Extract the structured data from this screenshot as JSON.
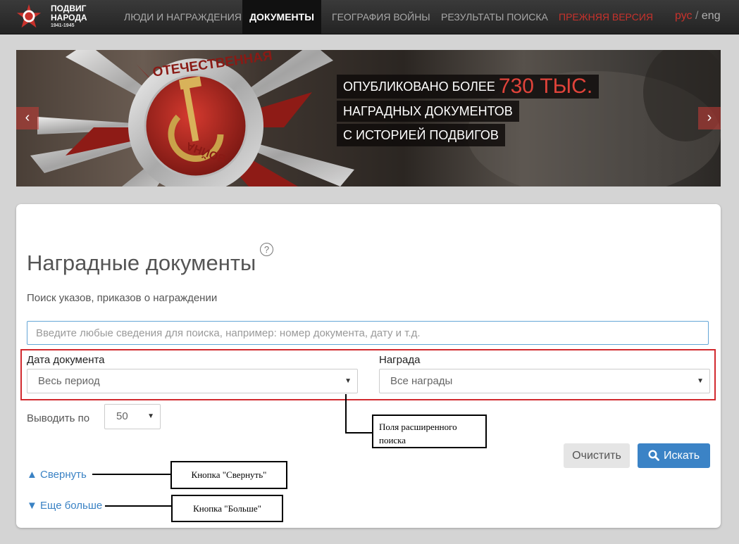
{
  "header": {
    "logo_line1": "ПОДВИГ",
    "logo_line2": "НАРОДА",
    "logo_years": "1941-1945",
    "nav": [
      {
        "label": "ЛЮДИ И НАГРАЖДЕНИЯ",
        "active": false
      },
      {
        "label": "ДОКУМЕНТЫ",
        "active": true
      },
      {
        "label": "ГЕОГРАФИЯ ВОЙНЫ",
        "active": false
      },
      {
        "label": "РЕЗУЛЬТАТЫ ПОИСКА",
        "active": false
      },
      {
        "label": "ПРЕЖНЯЯ ВЕРСИЯ",
        "active": false
      }
    ],
    "lang_ru": "рус",
    "lang_sep": "/",
    "lang_en": "eng"
  },
  "banner": {
    "line1_prefix": "ОПУБЛИКОВАНО БОЛЕЕ",
    "line1_highlight": "730 ТЫС.",
    "line2": "НАГРАДНЫХ ДОКУМЕНТОВ",
    "line3": "С ИСТОРИЕЙ ПОДВИГОВ",
    "arrow_prev": "‹",
    "arrow_next": "›"
  },
  "main": {
    "title": "Наградные документы",
    "help": "?",
    "subtitle": "Поиск указов, приказов о награждении",
    "search_placeholder": "Введите любые сведения для поиска, например: номер документа, дату и т.д.",
    "date_label": "Дата документа",
    "date_value": "Весь период",
    "award_label": "Награда",
    "award_value": "Все награды",
    "per_page_label": "Выводить по",
    "per_page_value": "50",
    "clear_button": "Очистить",
    "search_button": "Искать",
    "collapse_link": "▲ Свернуть",
    "more_link": "▼ Еще больше"
  },
  "annotations": {
    "advanced_fields": "Поля расширенного поиска",
    "collapse_button": "Кнопка \"Свернуть\"",
    "more_button": "Кнопка \"Больше\""
  },
  "colors": {
    "accent_red": "#c8322c",
    "link_blue": "#3a82c4",
    "button_blue": "#3b83c6"
  }
}
